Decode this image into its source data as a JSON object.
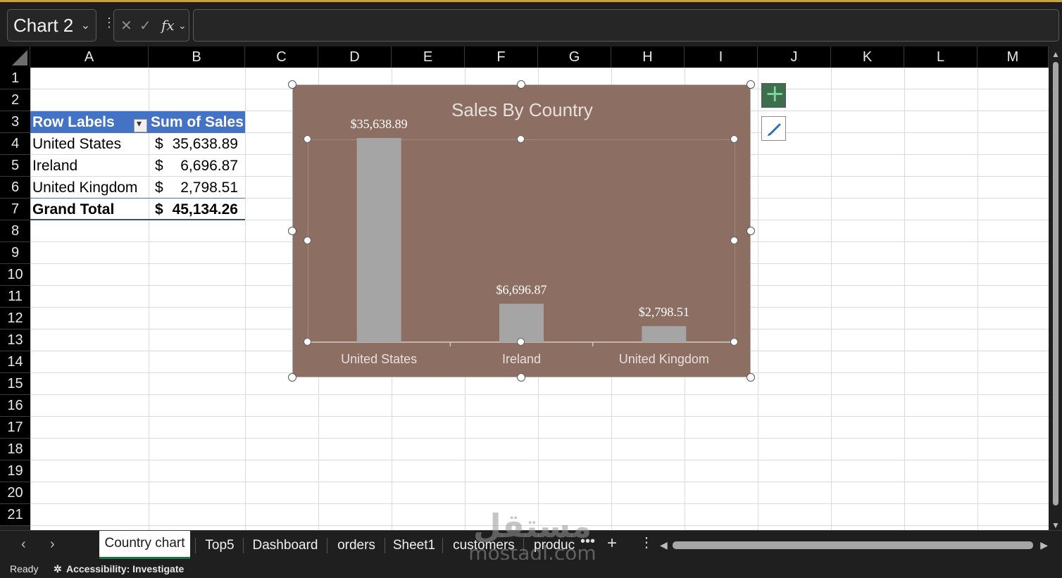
{
  "formula_bar": {
    "name_box": "Chart 2",
    "fx_label": "fx",
    "formula": ""
  },
  "columns": [
    "A",
    "B",
    "C",
    "D",
    "E",
    "F",
    "G",
    "H",
    "I",
    "J",
    "K",
    "L",
    "M"
  ],
  "rows": [
    "1",
    "2",
    "3",
    "4",
    "5",
    "6",
    "7",
    "8",
    "9",
    "10",
    "11",
    "12",
    "13",
    "14",
    "15",
    "16",
    "17",
    "18",
    "19",
    "20",
    "21"
  ],
  "pivot": {
    "header_labels": "Row Labels",
    "header_values": "Sum of Sales",
    "rows": [
      {
        "label": "United States",
        "currency": "$",
        "value": "35,638.89"
      },
      {
        "label": "Ireland",
        "currency": "$",
        "value": "6,696.87"
      },
      {
        "label": "United Kingdom",
        "currency": "$",
        "value": "2,798.51"
      }
    ],
    "total": {
      "label": "Grand Total",
      "currency": "$",
      "value": "45,134.26"
    }
  },
  "chart_data": {
    "type": "bar",
    "title": "Sales By Country",
    "categories": [
      "United States",
      "Ireland",
      "United Kingdom"
    ],
    "values": [
      35638.89,
      6696.87,
      2798.51
    ],
    "data_labels": [
      "$35,638.89",
      "$6,696.87",
      "$2,798.51"
    ],
    "xlabel": "",
    "ylabel": "",
    "ylim": [
      0,
      40000
    ],
    "grid": false,
    "legend": "none",
    "colors": {
      "background": "#8d6e63",
      "bar": "#a5a5a5",
      "text": "#e6e0dc"
    }
  },
  "sheet_tabs": {
    "tabs": [
      "Country chart",
      "Top5",
      "Dashboard",
      "orders",
      "Sheet1",
      "customers",
      "produc"
    ],
    "active": "Country chart",
    "more": "•••",
    "add": "+"
  },
  "status": {
    "ready": "Ready",
    "accessibility": "Accessibility: Investigate"
  },
  "watermark": {
    "arabic": "مستقل",
    "latin": "mostaql.com"
  }
}
